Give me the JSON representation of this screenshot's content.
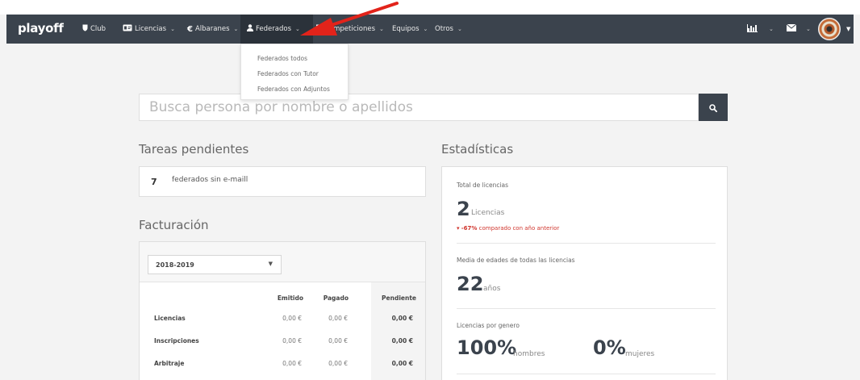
{
  "navbar": {
    "brand": "playoff",
    "items": [
      {
        "label": "Club",
        "icon": "shield-icon",
        "has_caret": false
      },
      {
        "label": "Licencias",
        "icon": "id-card-icon",
        "has_caret": true
      },
      {
        "label": "Albaranes",
        "icon": "euro-icon",
        "has_caret": true
      },
      {
        "label": "Federados",
        "icon": "user-icon",
        "has_caret": true,
        "active": true
      },
      {
        "label": "Competiciones",
        "icon": "trophy-icon",
        "has_caret": true
      },
      {
        "label": "Equipos",
        "icon": "",
        "has_caret": true
      },
      {
        "label": "Otros",
        "icon": "",
        "has_caret": true
      }
    ],
    "right": {
      "stats_icon": "bar-chart-icon",
      "mail_icon": "envelope-icon",
      "avatar": "club-logo-avatar"
    }
  },
  "dropdown": {
    "items": [
      "Federados todos",
      "Federados con Tutor",
      "Federados con Adjuntos"
    ]
  },
  "search": {
    "placeholder": "Busca persona por nombre o apellidos",
    "button_icon": "search-icon"
  },
  "tareas": {
    "title": "Tareas pendientes",
    "items": [
      {
        "count": "7",
        "text": "federados sin e-maill"
      }
    ]
  },
  "facturacion": {
    "title": "Facturación",
    "season": "2018-2019",
    "columns": [
      "Emitido",
      "Pagado",
      "Pendiente"
    ],
    "rows": [
      {
        "label": "Licencias",
        "emitido": "0,00 €",
        "pagado": "0,00 €",
        "pendiente": "0,00 €"
      },
      {
        "label": "Inscripciones",
        "emitido": "0,00 €",
        "pagado": "0,00 €",
        "pendiente": "0,00 €"
      },
      {
        "label": "Arbitraje",
        "emitido": "0,00 €",
        "pagado": "0,00 €",
        "pendiente": "0,00 €"
      }
    ]
  },
  "estadisticas": {
    "title": "Estadísticas",
    "total_label": "Total de licencias",
    "total_value": "2",
    "total_unit": "Licencias",
    "change_pct": "-67%",
    "change_text": "comparado con año anterior",
    "media_label": "Media de edades de todas las licencias",
    "media_value": "22",
    "media_unit": "años",
    "genero_label": "Licencias por genero",
    "hombres_value": "100%",
    "hombres_unit": "hombres",
    "mujeres_value": "0%",
    "mujeres_unit": "mujeres"
  },
  "colors": {
    "navbar": "#3b434d",
    "background": "#f3f3f3",
    "negative": "#d0342c",
    "arrow": "#e2231a"
  }
}
